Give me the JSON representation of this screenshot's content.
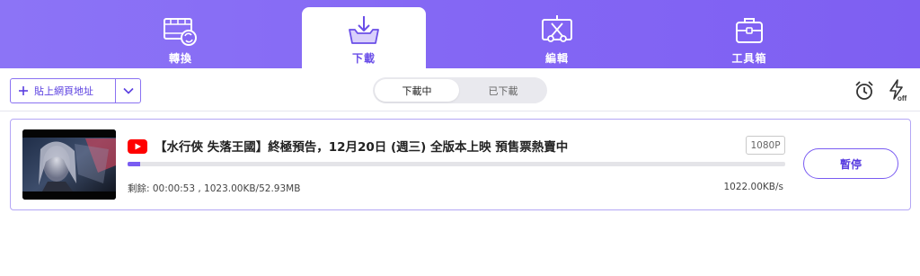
{
  "nav": {
    "tabs": [
      {
        "label": "轉換",
        "icon": "film-convert-icon"
      },
      {
        "label": "下載",
        "icon": "download-tray-icon"
      },
      {
        "label": "編輯",
        "icon": "edit-cut-icon"
      },
      {
        "label": "工具箱",
        "icon": "toolbox-icon"
      }
    ],
    "active_index": 1
  },
  "toolbar": {
    "paste_label": "貼上網頁地址",
    "segment": {
      "downloading": "下載中",
      "downloaded": "已下載",
      "selected": "下載中"
    },
    "icons": [
      "alarm-clock-icon",
      "turbo-off-icon"
    ]
  },
  "download": {
    "title": "【水行俠 失落王國】終極預告，12月20日 (週三) 全版本上映 預售票熱賣中",
    "source_icon": "youtube-icon",
    "resolution": "1080P",
    "progress_fraction": 0.019,
    "remaining": "剩餘: 00:00:53 , 1023.00KB/52.93MB",
    "speed": "1022.00KB/s",
    "pause_label": "暫停"
  },
  "colors": {
    "accent": "#7a5cf2",
    "nav_bg": "#8467f4",
    "youtube_red": "#ff0000"
  }
}
